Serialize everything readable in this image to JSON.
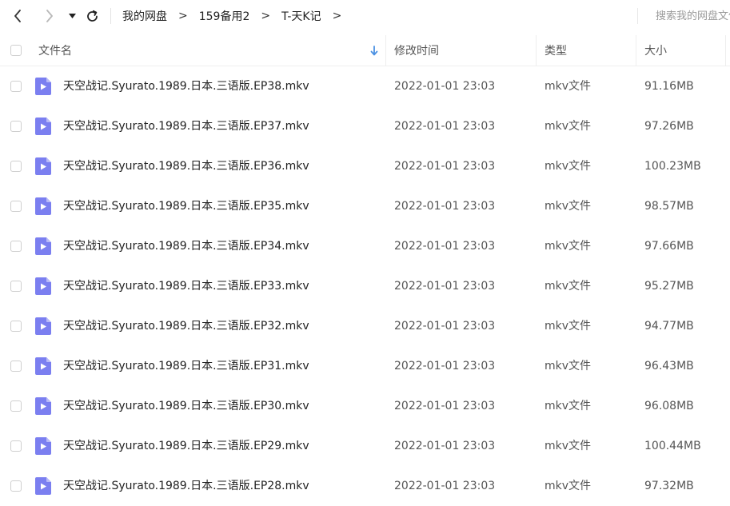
{
  "toolbar": {
    "back_icon": "chevron-left-icon",
    "forward_icon": "chevron-right-icon",
    "history_icon": "caret-down-icon",
    "refresh_icon": "refresh-icon"
  },
  "breadcrumb": {
    "items": [
      {
        "label": "我的网盘"
      },
      {
        "label": "159备用2"
      },
      {
        "label": "T-天K记"
      }
    ],
    "separator": ">"
  },
  "search": {
    "placeholder": "搜索我的网盘文件"
  },
  "table": {
    "columns": {
      "name": "文件名",
      "modified": "修改时间",
      "type": "类型",
      "size": "大小"
    },
    "sort_icon": "arrow-down-icon",
    "accent_color": "#4a90e2",
    "file_icon_color": "#7b7ff0",
    "rows": [
      {
        "name": "天空战记.Syurato.1989.日本.三语版.EP38.mkv",
        "modified": "2022-01-01 23:03",
        "type": "mkv文件",
        "size": "91.16MB"
      },
      {
        "name": "天空战记.Syurato.1989.日本.三语版.EP37.mkv",
        "modified": "2022-01-01 23:03",
        "type": "mkv文件",
        "size": "97.26MB"
      },
      {
        "name": "天空战记.Syurato.1989.日本.三语版.EP36.mkv",
        "modified": "2022-01-01 23:03",
        "type": "mkv文件",
        "size": "100.23MB"
      },
      {
        "name": "天空战记.Syurato.1989.日本.三语版.EP35.mkv",
        "modified": "2022-01-01 23:03",
        "type": "mkv文件",
        "size": "98.57MB"
      },
      {
        "name": "天空战记.Syurato.1989.日本.三语版.EP34.mkv",
        "modified": "2022-01-01 23:03",
        "type": "mkv文件",
        "size": "97.66MB"
      },
      {
        "name": "天空战记.Syurato.1989.日本.三语版.EP33.mkv",
        "modified": "2022-01-01 23:03",
        "type": "mkv文件",
        "size": "95.27MB"
      },
      {
        "name": "天空战记.Syurato.1989.日本.三语版.EP32.mkv",
        "modified": "2022-01-01 23:03",
        "type": "mkv文件",
        "size": "94.77MB"
      },
      {
        "name": "天空战记.Syurato.1989.日本.三语版.EP31.mkv",
        "modified": "2022-01-01 23:03",
        "type": "mkv文件",
        "size": "96.43MB"
      },
      {
        "name": "天空战记.Syurato.1989.日本.三语版.EP30.mkv",
        "modified": "2022-01-01 23:03",
        "type": "mkv文件",
        "size": "96.08MB"
      },
      {
        "name": "天空战记.Syurato.1989.日本.三语版.EP29.mkv",
        "modified": "2022-01-01 23:03",
        "type": "mkv文件",
        "size": "100.44MB"
      },
      {
        "name": "天空战记.Syurato.1989.日本.三语版.EP28.mkv",
        "modified": "2022-01-01 23:03",
        "type": "mkv文件",
        "size": "97.32MB"
      }
    ]
  }
}
